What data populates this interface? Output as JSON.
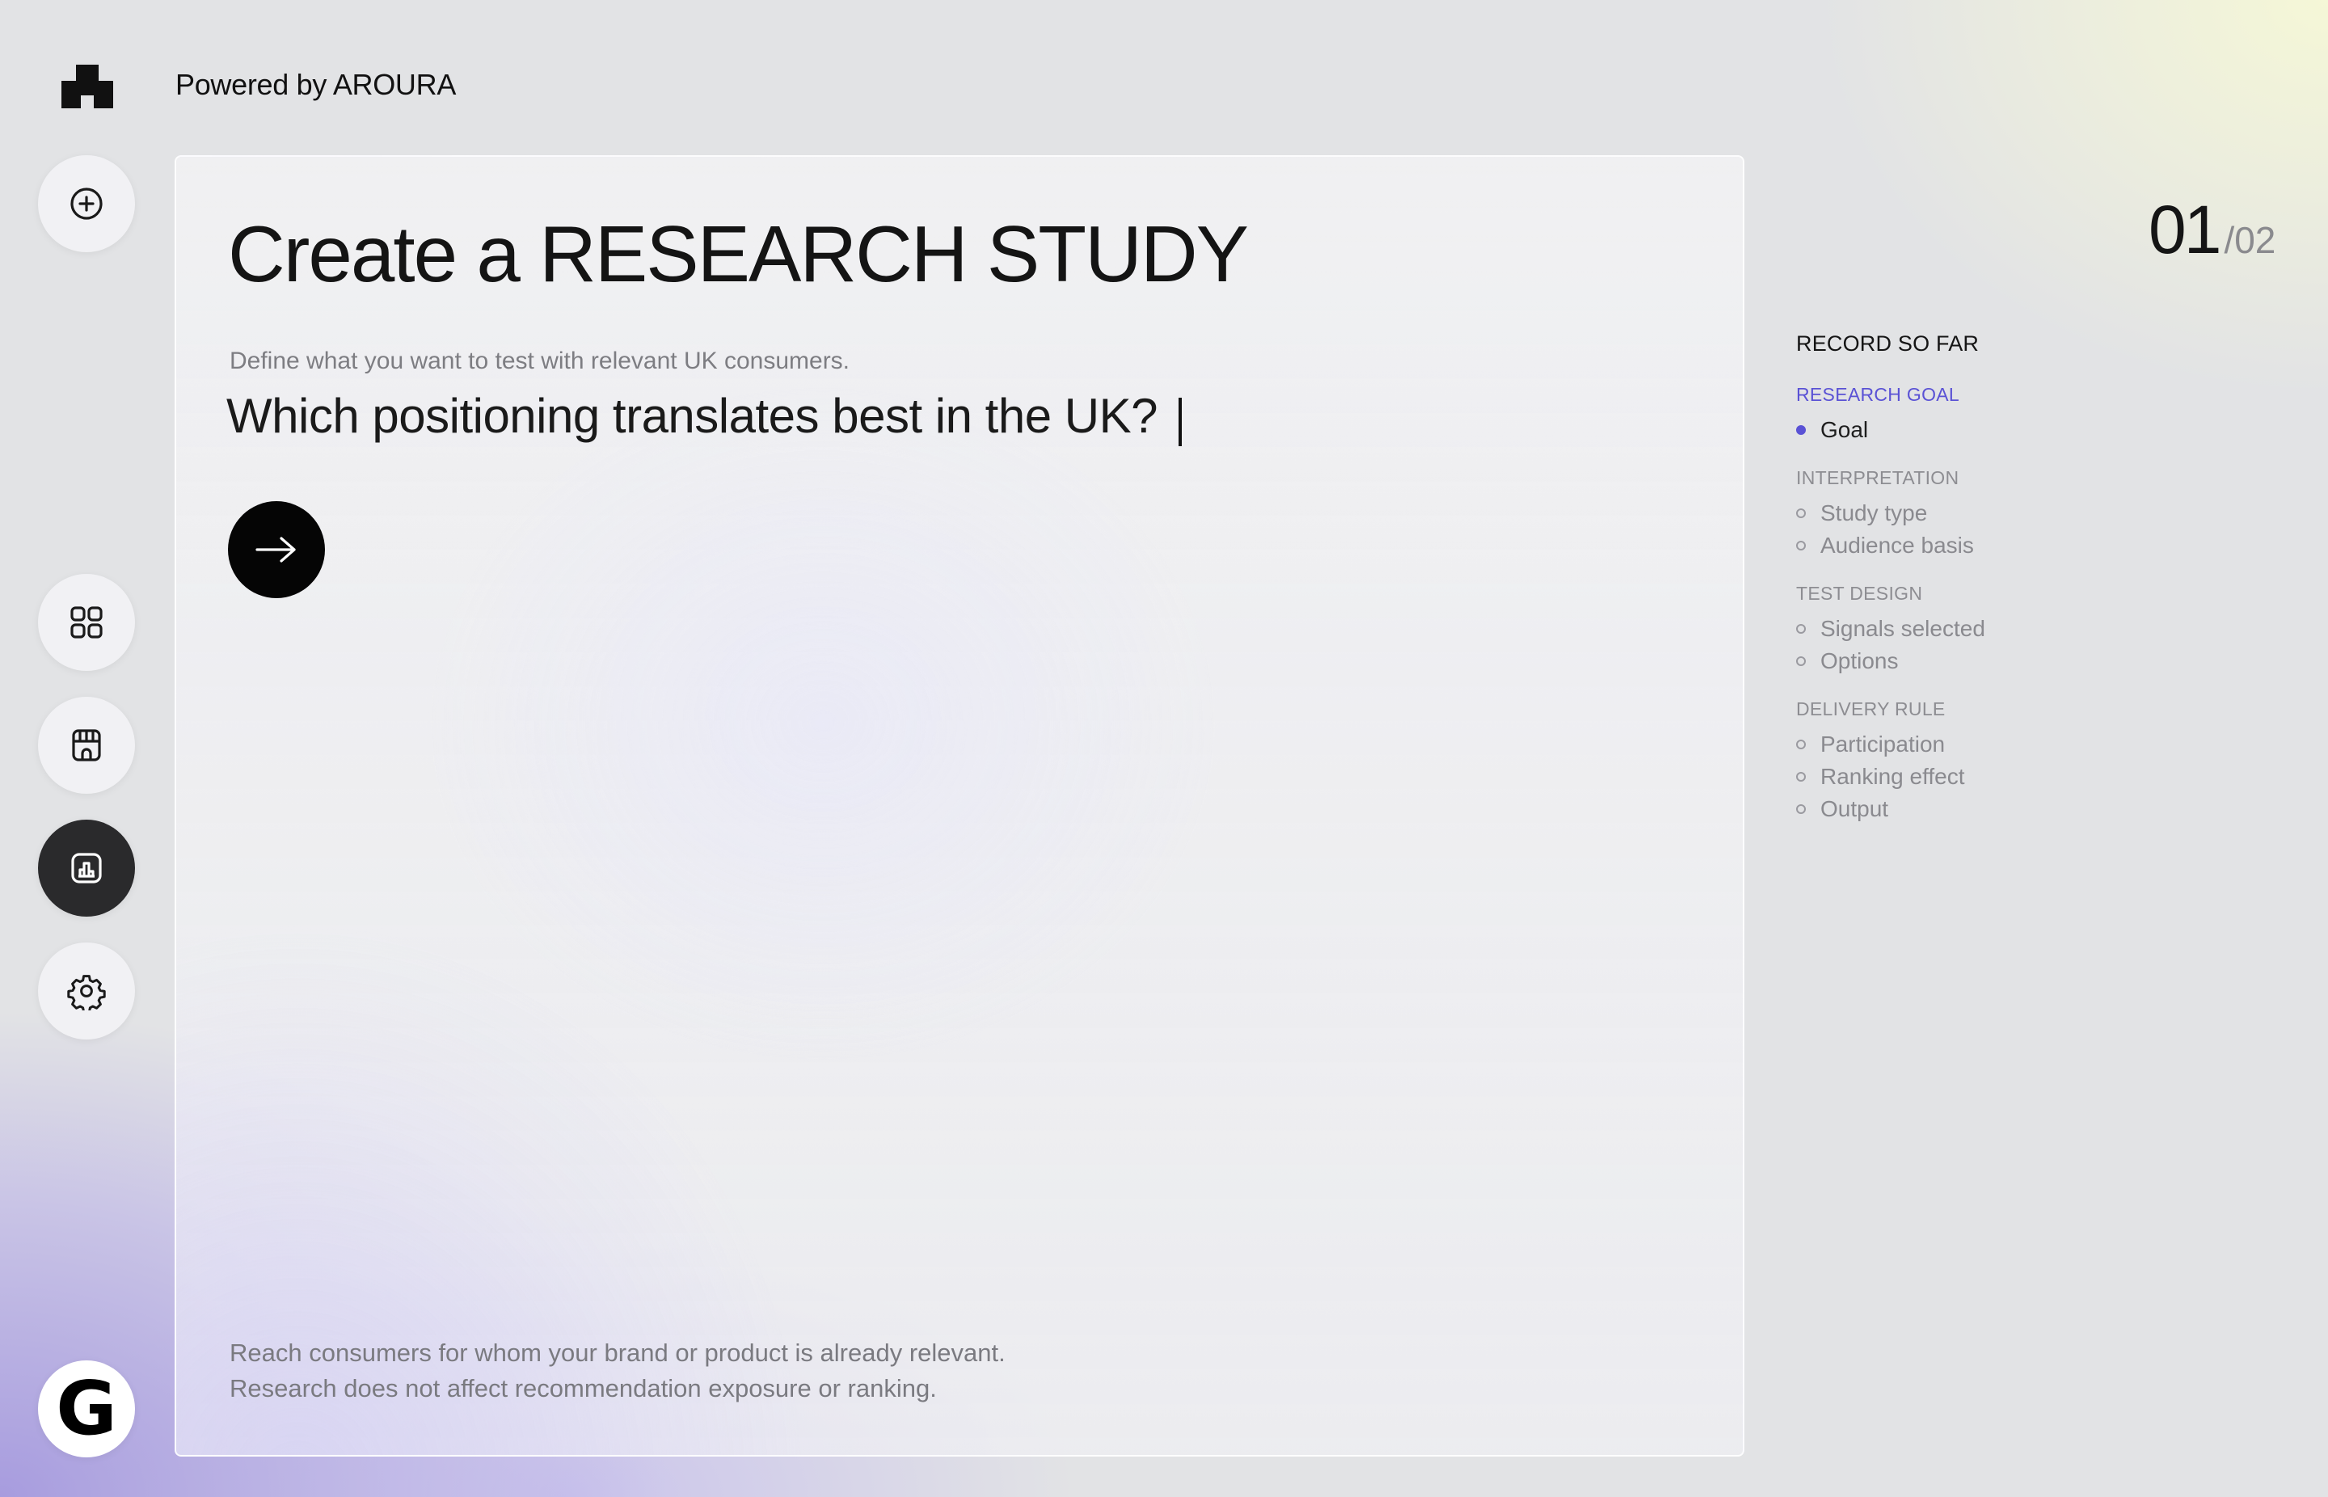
{
  "header": {
    "powered_by": "Powered by AROURA"
  },
  "rail": {
    "items": [
      {
        "name": "new",
        "icon": "plus-circle-icon",
        "active": false
      },
      {
        "name": "dashboard",
        "icon": "grid-icon",
        "active": false
      },
      {
        "name": "store",
        "icon": "storefront-icon",
        "active": false
      },
      {
        "name": "research",
        "icon": "chart-icon",
        "active": true
      },
      {
        "name": "settings",
        "icon": "gear-icon",
        "active": false
      }
    ],
    "brand_letter": "G"
  },
  "card": {
    "title": "Create a RESEARCH STUDY",
    "hint": "Define what you want to test with relevant UK consumers.",
    "goal_value": "Which positioning translates best in the UK?",
    "submit_icon": "arrow-right-icon",
    "footer_line1": "Reach consumers for whom your brand or product is already relevant.",
    "footer_line2": "Research does not affect recommendation exposure or ranking."
  },
  "step": {
    "current": "01",
    "total": "/02"
  },
  "record": {
    "title": "RECORD SO FAR",
    "sections": [
      {
        "label": "RESEARCH GOAL",
        "items": [
          {
            "label": "Goal",
            "filled": true
          }
        ]
      },
      {
        "label": "INTERPRETATION",
        "items": [
          {
            "label": "Study type",
            "filled": false
          },
          {
            "label": "Audience basis",
            "filled": false
          }
        ]
      },
      {
        "label": "TEST DESIGN",
        "items": [
          {
            "label": "Signals selected",
            "filled": false
          },
          {
            "label": "Options",
            "filled": false
          }
        ]
      },
      {
        "label": "DELIVERY RULE",
        "items": [
          {
            "label": "Participation",
            "filled": false
          },
          {
            "label": "Ranking effect",
            "filled": false
          },
          {
            "label": "Output",
            "filled": false
          }
        ]
      }
    ]
  },
  "colors": {
    "accent": "#5a52d5",
    "active_rail": "#2a2a2c",
    "submit": "#050505"
  }
}
